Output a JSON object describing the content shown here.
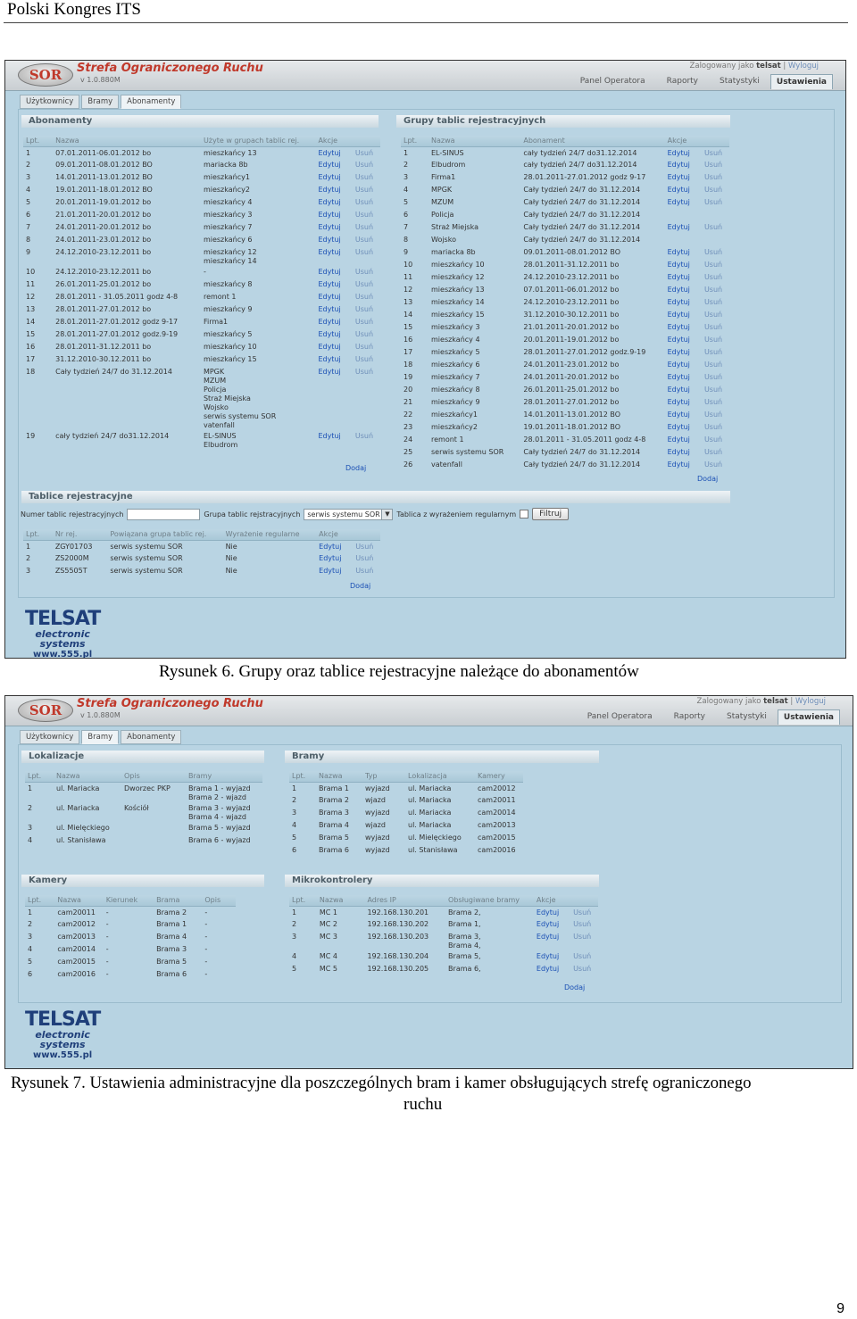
{
  "doc": {
    "header": "Polski Kongres ITS",
    "caption1": "Rysunek 6. Grupy oraz tablice rejestracyjne należące do abonamentów",
    "caption2_line1": "Rysunek 7. Ustawienia administracyjne dla poszczególnych bram i kamer obsługujących strefę ograniczonego",
    "caption2_line2": "ruchu",
    "page_number": "9"
  },
  "app": {
    "logo": "SOR",
    "title": "Strefa Ograniczonego Ruchu",
    "version": "v 1.0.880M",
    "logged_prefix": "Zalogowany jako",
    "user": "telsat",
    "logout": "Wyloguj",
    "menu": [
      "Panel Operatora",
      "Raporty",
      "Statystyki",
      "Ustawienia"
    ],
    "subtabs": [
      "Użytkownicy",
      "Bramy",
      "Abonamenty"
    ],
    "brand": {
      "line1": "TELSAT",
      "line2": "electronic",
      "line3": "systems",
      "line4": "www.555.pl"
    }
  },
  "shot1": {
    "abonamenty": {
      "title": "Abonamenty",
      "headers": [
        "Lpt.",
        "Nazwa",
        "Użyte w grupach tablic rej.",
        "Akcje",
        ""
      ],
      "rows": [
        [
          "1",
          "07.01.2011-06.01.2012 bo",
          "mieszkańcy 13",
          "Edytuj",
          "Usuń"
        ],
        [
          "2",
          "09.01.2011-08.01.2012 BO",
          "mariacka 8b",
          "Edytuj",
          "Usuń"
        ],
        [
          "3",
          "14.01.2011-13.01.2012 BO",
          "mieszkańcy1",
          "Edytuj",
          "Usuń"
        ],
        [
          "4",
          "19.01.2011-18.01.2012 BO",
          "mieszkańcy2",
          "Edytuj",
          "Usuń"
        ],
        [
          "5",
          "20.01.2011-19.01.2012 bo",
          "mieszkańcy 4",
          "Edytuj",
          "Usuń"
        ],
        [
          "6",
          "21.01.2011-20.01.2012 bo",
          "mieszkańcy 3",
          "Edytuj",
          "Usuń"
        ],
        [
          "7",
          "24.01.2011-20.01.2012 bo",
          "mieszkańcy 7",
          "Edytuj",
          "Usuń"
        ],
        [
          "8",
          "24.01.2011-23.01.2012 bo",
          "mieszkańcy 6",
          "Edytuj",
          "Usuń"
        ],
        [
          "9",
          "24.12.2010-23.12.2011 bo",
          "mieszkańcy 12\nmieszkańcy 14",
          "Edytuj",
          "Usuń"
        ],
        [
          "10",
          "24.12.2010-23.12.2011 bo",
          "-",
          "Edytuj",
          "Usuń"
        ],
        [
          "11",
          "26.01.2011-25.01.2012 bo",
          "mieszkańcy 8",
          "Edytuj",
          "Usuń"
        ],
        [
          "12",
          "28.01.2011 - 31.05.2011 godz 4-8",
          "remont 1",
          "Edytuj",
          "Usuń"
        ],
        [
          "13",
          "28.01.2011-27.01.2012 bo",
          "mieszkańcy 9",
          "Edytuj",
          "Usuń"
        ],
        [
          "14",
          "28.01.2011-27.01.2012 godz 9-17",
          "Firma1",
          "Edytuj",
          "Usuń"
        ],
        [
          "15",
          "28.01.2011-27.01.2012 godz.9-19",
          "mieszkańcy 5",
          "Edytuj",
          "Usuń"
        ],
        [
          "16",
          "28.01.2011-31.12.2011 bo",
          "mieszkańcy 10",
          "Edytuj",
          "Usuń"
        ],
        [
          "17",
          "31.12.2010-30.12.2011 bo",
          "mieszkańcy 15",
          "Edytuj",
          "Usuń"
        ],
        [
          "18",
          "Cały tydzień 24/7 do 31.12.2014",
          "MPGK\nMZUM\nPolicja\nStraż Miejska\nWojsko\nserwis systemu SOR\nvatenfall",
          "Edytuj",
          "Usuń"
        ],
        [
          "19",
          "cały tydzień 24/7 do31.12.2014",
          "EL-SINUS\nElbudrom",
          "Edytuj",
          "Usuń"
        ]
      ],
      "add": "Dodaj"
    },
    "grupy": {
      "title": "Grupy tablic rejestracyjnych",
      "headers": [
        "Lpt.",
        "Nazwa",
        "Abonament",
        "Akcje",
        ""
      ],
      "rows": [
        [
          "1",
          "EL-SINUS",
          "cały tydzień 24/7 do31.12.2014",
          "Edytuj",
          "Usuń"
        ],
        [
          "2",
          "Elbudrom",
          "cały tydzień 24/7 do31.12.2014",
          "Edytuj",
          "Usuń"
        ],
        [
          "3",
          "Firma1",
          "28.01.2011-27.01.2012 godz 9-17",
          "Edytuj",
          "Usuń"
        ],
        [
          "4",
          "MPGK",
          "Cały tydzień 24/7 do 31.12.2014",
          "Edytuj",
          "Usuń"
        ],
        [
          "5",
          "MZUM",
          "Cały tydzień 24/7 do 31.12.2014",
          "Edytuj",
          "Usuń"
        ],
        [
          "6",
          "Policja",
          "Cały tydzień 24/7 do 31.12.2014",
          "",
          ""
        ],
        [
          "7",
          "Straż Miejska",
          "Cały tydzień 24/7 do 31.12.2014",
          "Edytuj",
          "Usuń"
        ],
        [
          "8",
          "Wojsko",
          "Cały tydzień 24/7 do 31.12.2014",
          "",
          ""
        ],
        [
          "9",
          "mariacka 8b",
          "09.01.2011-08.01.2012 BO",
          "Edytuj",
          "Usuń"
        ],
        [
          "10",
          "mieszkańcy 10",
          "28.01.2011-31.12.2011 bo",
          "Edytuj",
          "Usuń"
        ],
        [
          "11",
          "mieszkańcy 12",
          "24.12.2010-23.12.2011 bo",
          "Edytuj",
          "Usuń"
        ],
        [
          "12",
          "mieszkańcy 13",
          "07.01.2011-06.01.2012 bo",
          "Edytuj",
          "Usuń"
        ],
        [
          "13",
          "mieszkańcy 14",
          "24.12.2010-23.12.2011 bo",
          "Edytuj",
          "Usuń"
        ],
        [
          "14",
          "mieszkańcy 15",
          "31.12.2010-30.12.2011 bo",
          "Edytuj",
          "Usuń"
        ],
        [
          "15",
          "mieszkańcy 3",
          "21.01.2011-20.01.2012 bo",
          "Edytuj",
          "Usuń"
        ],
        [
          "16",
          "mieszkańcy 4",
          "20.01.2011-19.01.2012 bo",
          "Edytuj",
          "Usuń"
        ],
        [
          "17",
          "mieszkańcy 5",
          "28.01.2011-27.01.2012 godz.9-19",
          "Edytuj",
          "Usuń"
        ],
        [
          "18",
          "mieszkańcy 6",
          "24.01.2011-23.01.2012 bo",
          "Edytuj",
          "Usuń"
        ],
        [
          "19",
          "mieszkańcy 7",
          "24.01.2011-20.01.2012 bo",
          "Edytuj",
          "Usuń"
        ],
        [
          "20",
          "mieszkańcy 8",
          "26.01.2011-25.01.2012 bo",
          "Edytuj",
          "Usuń"
        ],
        [
          "21",
          "mieszkańcy 9",
          "28.01.2011-27.01.2012 bo",
          "Edytuj",
          "Usuń"
        ],
        [
          "22",
          "mieszkańcy1",
          "14.01.2011-13.01.2012 BO",
          "Edytuj",
          "Usuń"
        ],
        [
          "23",
          "mieszkańcy2",
          "19.01.2011-18.01.2012 BO",
          "Edytuj",
          "Usuń"
        ],
        [
          "24",
          "remont 1",
          "28.01.2011 - 31.05.2011 godz 4-8",
          "Edytuj",
          "Usuń"
        ],
        [
          "25",
          "serwis systemu SOR",
          "Cały tydzień 24/7 do 31.12.2014",
          "Edytuj",
          "Usuń"
        ],
        [
          "26",
          "vatenfall",
          "Cały tydzień 24/7 do 31.12.2014",
          "Edytuj",
          "Usuń"
        ]
      ],
      "add": "Dodaj"
    },
    "tablice": {
      "title": "Tablice rejestracyjne",
      "filter_label1": "Numer tablic rejestracyjnych",
      "filter_label2": "Grupa tablic rejstracyjnych",
      "group_value": "serwis systemu SOR",
      "filter_label3": "Tablica z wyrażeniem regularnym",
      "filter_button": "Filtruj",
      "headers": [
        "Lpt.",
        "Nr rej.",
        "Powiązana grupa tablic rej.",
        "Wyrażenie regularne",
        "Akcje",
        ""
      ],
      "rows": [
        [
          "1",
          "ZGY01703",
          "serwis systemu SOR",
          "Nie",
          "Edytuj",
          "Usuń"
        ],
        [
          "2",
          "ZS2000M",
          "serwis systemu SOR",
          "Nie",
          "Edytuj",
          "Usuń"
        ],
        [
          "3",
          "ZS5505T",
          "serwis systemu SOR",
          "Nie",
          "Edytuj",
          "Usuń"
        ]
      ],
      "add": "Dodaj"
    }
  },
  "shot2": {
    "lokalizacje": {
      "title": "Lokalizacje",
      "headers": [
        "Lpt.",
        "Nazwa",
        "Opis",
        "Bramy"
      ],
      "rows": [
        [
          "1",
          "ul. Mariacka",
          "Dworzec PKP",
          "Brama 1 - wyjazd\nBrama 2 - wjazd"
        ],
        [
          "2",
          "ul. Mariacka",
          "Kościół",
          "Brama 3 - wyjazd\nBrama 4 - wjazd"
        ],
        [
          "3",
          "ul. Mielęckiego",
          "",
          "Brama 5 - wyjazd"
        ],
        [
          "4",
          "ul. Stanisława",
          "",
          "Brama 6 - wyjazd"
        ]
      ]
    },
    "bramy": {
      "title": "Bramy",
      "headers": [
        "Lpt.",
        "Nazwa",
        "Typ",
        "Lokalizacja",
        "Kamery"
      ],
      "rows": [
        [
          "1",
          "Brama 1",
          "wyjazd",
          "ul. Mariacka",
          "cam20012"
        ],
        [
          "2",
          "Brama 2",
          "wjazd",
          "ul. Mariacka",
          "cam20011"
        ],
        [
          "3",
          "Brama 3",
          "wyjazd",
          "ul. Mariacka",
          "cam20014"
        ],
        [
          "4",
          "Brama 4",
          "wjazd",
          "ul. Mariacka",
          "cam20013"
        ],
        [
          "5",
          "Brama 5",
          "wyjazd",
          "ul. Mielęckiego",
          "cam20015"
        ],
        [
          "6",
          "Brama 6",
          "wyjazd",
          "ul. Stanisława",
          "cam20016"
        ]
      ]
    },
    "kamery": {
      "title": "Kamery",
      "headers": [
        "Lpt.",
        "Nazwa",
        "Kierunek",
        "Brama",
        "Opis"
      ],
      "rows": [
        [
          "1",
          "cam20011",
          "-",
          "Brama 2",
          "-"
        ],
        [
          "2",
          "cam20012",
          "-",
          "Brama 1",
          "-"
        ],
        [
          "3",
          "cam20013",
          "-",
          "Brama 4",
          "-"
        ],
        [
          "4",
          "cam20014",
          "-",
          "Brama 3",
          "-"
        ],
        [
          "5",
          "cam20015",
          "-",
          "Brama 5",
          "-"
        ],
        [
          "6",
          "cam20016",
          "-",
          "Brama 6",
          "-"
        ]
      ]
    },
    "mikrokontrolery": {
      "title": "Mikrokontrolery",
      "headers": [
        "Lpt.",
        "Nazwa",
        "Adres IP",
        "Obsługiwane bramy",
        "Akcje",
        ""
      ],
      "rows": [
        [
          "1",
          "MC 1",
          "192.168.130.201",
          "Brama 2,",
          "Edytuj",
          "Usuń"
        ],
        [
          "2",
          "MC 2",
          "192.168.130.202",
          "Brama 1,",
          "Edytuj",
          "Usuń"
        ],
        [
          "3",
          "MC 3",
          "192.168.130.203",
          "Brama 3,\nBrama 4,",
          "Edytuj",
          "Usuń"
        ],
        [
          "4",
          "MC 4",
          "192.168.130.204",
          "Brama 5,",
          "Edytuj",
          "Usuń"
        ],
        [
          "5",
          "MC 5",
          "192.168.130.205",
          "Brama 6,",
          "Edytuj",
          "Usuń"
        ]
      ],
      "add": "Dodaj"
    }
  }
}
